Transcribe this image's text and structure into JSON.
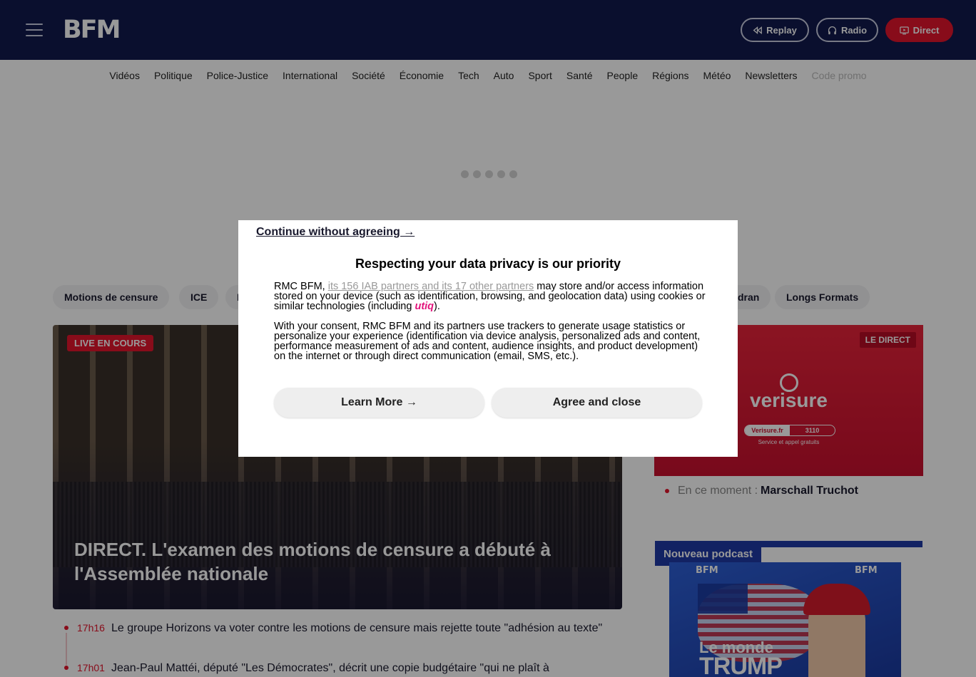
{
  "header": {
    "logo": "BFM",
    "buttons": {
      "replay": "Replay",
      "radio": "Radio",
      "direct": "Direct"
    },
    "accent": "#e3142c",
    "background": "#111a4e"
  },
  "nav": {
    "items": [
      "Vidéos",
      "Politique",
      "Police-Justice",
      "International",
      "Société",
      "Économie",
      "Tech",
      "Auto",
      "Sport",
      "Santé",
      "People",
      "Régions",
      "Météo",
      "Newsletters",
      "Code promo"
    ]
  },
  "topics": {
    "visible": [
      "Motions de censure",
      "ICE",
      "I",
      "dran",
      "Longs Formats"
    ]
  },
  "main_story": {
    "badge": "LIVE EN COURS",
    "title": "DIRECT. L'examen des motions de censure a débuté à l'Assemblée nationale"
  },
  "live_feed": [
    {
      "time": "17h16",
      "text": "Le groupe Horizons va voter contre les motions de censure mais rejette toute \"adhésion au texte\""
    },
    {
      "time": "17h01",
      "text": "Jean-Paul Mattéi, député \"Les Démocrates\", décrit une copie budgétaire \"qui ne plaît à"
    }
  ],
  "live_player": {
    "badge": "LE DIRECT",
    "ad_brand": "verisure",
    "ad_cta_site": "Verisure.fr",
    "ad_cta_phone": "3110",
    "ad_sub": "Service et appel gratuits",
    "now_label": "En ce moment :",
    "now_value": "Marschall Truchot"
  },
  "podcast": {
    "tag": "Nouveau podcast",
    "brand_left": "BFM",
    "brand_right": "BFM",
    "title_line1": "Le monde",
    "title_line2": "TRUMP"
  },
  "consent": {
    "continue_link": "Continue without agreeing →",
    "title": "Respecting your data privacy is our priority",
    "para1_prefix": "RMC BFM, ",
    "para1_link": "its 156 IAB partners and its 17 other partners",
    "para1_suffix": " may store and/or access information stored on your device (such as identification, browsing, and geolocation data) using cookies or similar technologies (including ",
    "para1_brand": "utiq",
    "para1_end": ").",
    "para2": "With your consent, RMC BFM and its partners use trackers to generate usage statistics or personalize your experience (identification via device analysis, personalized ads and content, performance measurement of ads and content, audience insights, and product development) on the internet or through direct communication (email, SMS, etc.).",
    "learn_more": "Learn More →",
    "agree": "Agree and close"
  }
}
